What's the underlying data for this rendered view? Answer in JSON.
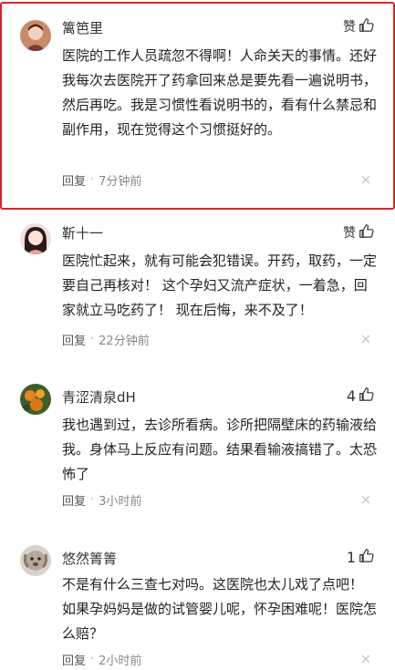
{
  "colors": {
    "highlight_border": "#d6262b",
    "meta_text": "#888888",
    "body_text": "#222222"
  },
  "comments": [
    {
      "username": "篱笆里",
      "avatar_icon": "user-avatar-icon",
      "like_label": "赞",
      "text": "医院的工作人员疏忽不得啊！人命关天的事情。还好我每次去医院开了药拿回来总是要先看一遍说明书，然后再吃。我是习惯性看说明书的，看有什么禁忌和副作用，现在觉得这个习惯挺好的。",
      "reply_label": "回复",
      "dot": "·",
      "time": "7分钟前",
      "highlighted": true
    },
    {
      "username": "靳十一",
      "avatar_icon": "user-avatar-icon",
      "like_label": "赞",
      "text": "医院忙起来，就有可能会犯错误。开药，取药，一定要自己再核对！ 这个孕妇又流产症状，一着急，回家就立马吃药了！ 现在后悔，来不及了！",
      "reply_label": "回复",
      "dot": "·",
      "time": "22分钟前",
      "highlighted": false
    },
    {
      "username": "青涩清泉dH",
      "avatar_icon": "user-avatar-icon",
      "like_label": "4",
      "text": "我也遇到过，去诊所看病。诊所把隔壁床的药输液给我。身体马上反应有问题。结果看输液搞错了。太恐怖了",
      "reply_label": "回复",
      "dot": "·",
      "time": "3小时前",
      "highlighted": false
    },
    {
      "username": "悠然箐箐",
      "avatar_icon": "user-avatar-icon",
      "like_label": "1",
      "text": "不是有什么三查七对吗。这医院也太儿戏了点吧！ 如果孕妈妈是做的试管婴儿呢，怀孕困难呢！医院怎么赔？",
      "reply_label": "回复",
      "dot": "·",
      "time": "2小时前",
      "highlighted": false
    }
  ]
}
